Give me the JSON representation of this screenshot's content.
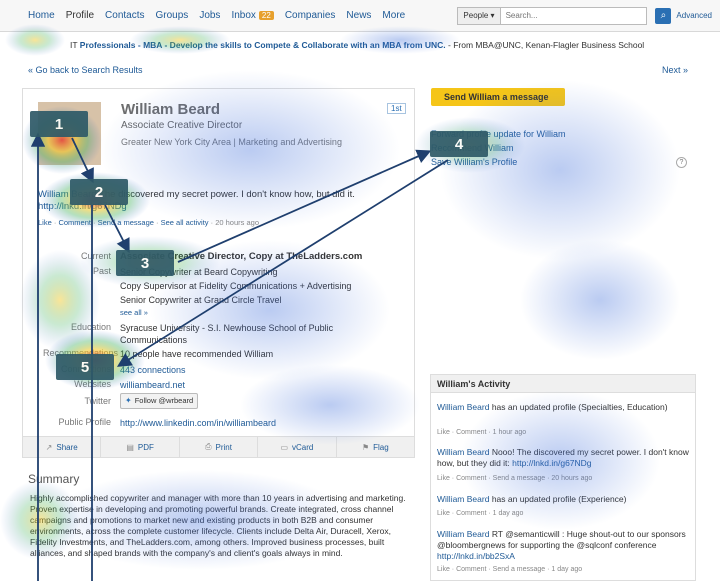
{
  "nav": {
    "items": [
      "Home",
      "Profile",
      "Contacts",
      "Groups",
      "Jobs",
      "Inbox",
      "Companies",
      "News",
      "More"
    ],
    "inbox_count": "22",
    "search_type": "People",
    "search_placeholder": "Search...",
    "advanced": "Advanced"
  },
  "ad": {
    "prefix": "IT",
    "bold_text": "Professionals - MBA - Develop the skills to Compete & Collaborate with an MBA from UNC.",
    "source": "- From MBA@UNC, Kenan-Flagler Business School"
  },
  "back_link": "« Go back to Search Results",
  "next_link": "Next »",
  "profile": {
    "name": "William Beard",
    "headline": "Associate Creative Director",
    "location": "Greater New York City Area | Marketing and Advertising",
    "conn_badge": "1st",
    "status_name": "William Beard",
    "status_text": "The discovered my secret power. I don't know how, but did it.",
    "status_link": "http://lnkd.in/g67NDg",
    "status_meta_like": "Like",
    "status_meta_comment": "Comment",
    "status_meta_send": "Send a message",
    "status_meta_see": "See all activity",
    "status_meta_time": "20 hours ago",
    "current_label": "Current",
    "current_value": "Associate Creative Director, Copy at TheLadders.com",
    "past_label": "Past",
    "past_values": [
      "Senior Copywriter at Beard Copywriting",
      "Copy Supervisor at Fidelity Communications + Advertising",
      "Senior Copywriter at Grand Circle Travel"
    ],
    "see_all": "see all »",
    "education_label": "Education",
    "education_value": "Syracuse University - S.I. Newhouse School of Public Communications",
    "recommendations_label": "Recommendations",
    "recommendations_value": "10 people have recommended William",
    "connections_label": "Connections",
    "connections_value": "443 connections",
    "websites_label": "Websites",
    "websites_value": "williambeard.net",
    "twitter_label": "Twitter",
    "twitter_value": "Follow @wrbeard",
    "public_label": "Public Profile",
    "public_value": "http://www.linkedin.com/in/williambeard"
  },
  "actions": [
    "Share",
    "PDF",
    "Print",
    "vCard",
    "Flag"
  ],
  "summary": {
    "title": "Summary",
    "text": "Highly accomplished copywriter and manager with more than 10 years in advertising and marketing. Proven expertise in developing and promoting powerful brands. Create integrated, cross channel campaigns and promotions to market new and existing products in both B2B and consumer environments, across the complete customer lifecycle. Clients include Delta Air, Duracell, Xerox, Fidelity Investments, and TheLadders.com, among others. Improved business processes, built alliances, and shaped brands with the company's and client's goals always in mind."
  },
  "sidebar": {
    "send_message": "Send William a message",
    "links": [
      "Forward profile update for William",
      "Recommend William",
      "Save William's Profile"
    ],
    "help": "?"
  },
  "activity": {
    "title": "William's Activity",
    "items": [
      {
        "who": "William Beard",
        "text": "has an updated profile (Specialties, Education)",
        "meta": "1 hour ago"
      },
      {
        "who": "William Beard",
        "text": "Nooo! The discovered my secret power. I don't know how, but they did it:",
        "link": "http://lnkd.in/g67NDg",
        "meta": "Send a message · 20 hours ago"
      },
      {
        "who": "William Beard",
        "text": "has an updated profile (Experience)",
        "meta": "1 day ago"
      },
      {
        "who": "William Beard",
        "text": "RT @semanticwill : Huge shout-out to our sponsors @bloombergnews for supporting the @sqlconf conference",
        "link": "http://lnkd.in/bb2SxA",
        "meta": "Send a message · 1 day ago"
      }
    ],
    "meta_like": "Like",
    "meta_comment": "Comment"
  },
  "fixations": [
    "1",
    "2",
    "3",
    "4",
    "5"
  ],
  "colors": {
    "link": "#1f5a96",
    "send_button": "#f5c518",
    "inbox_badge": "#e7a02d",
    "fixation_box": "#2f5a68",
    "gaze_line": "#1f3f6e"
  }
}
